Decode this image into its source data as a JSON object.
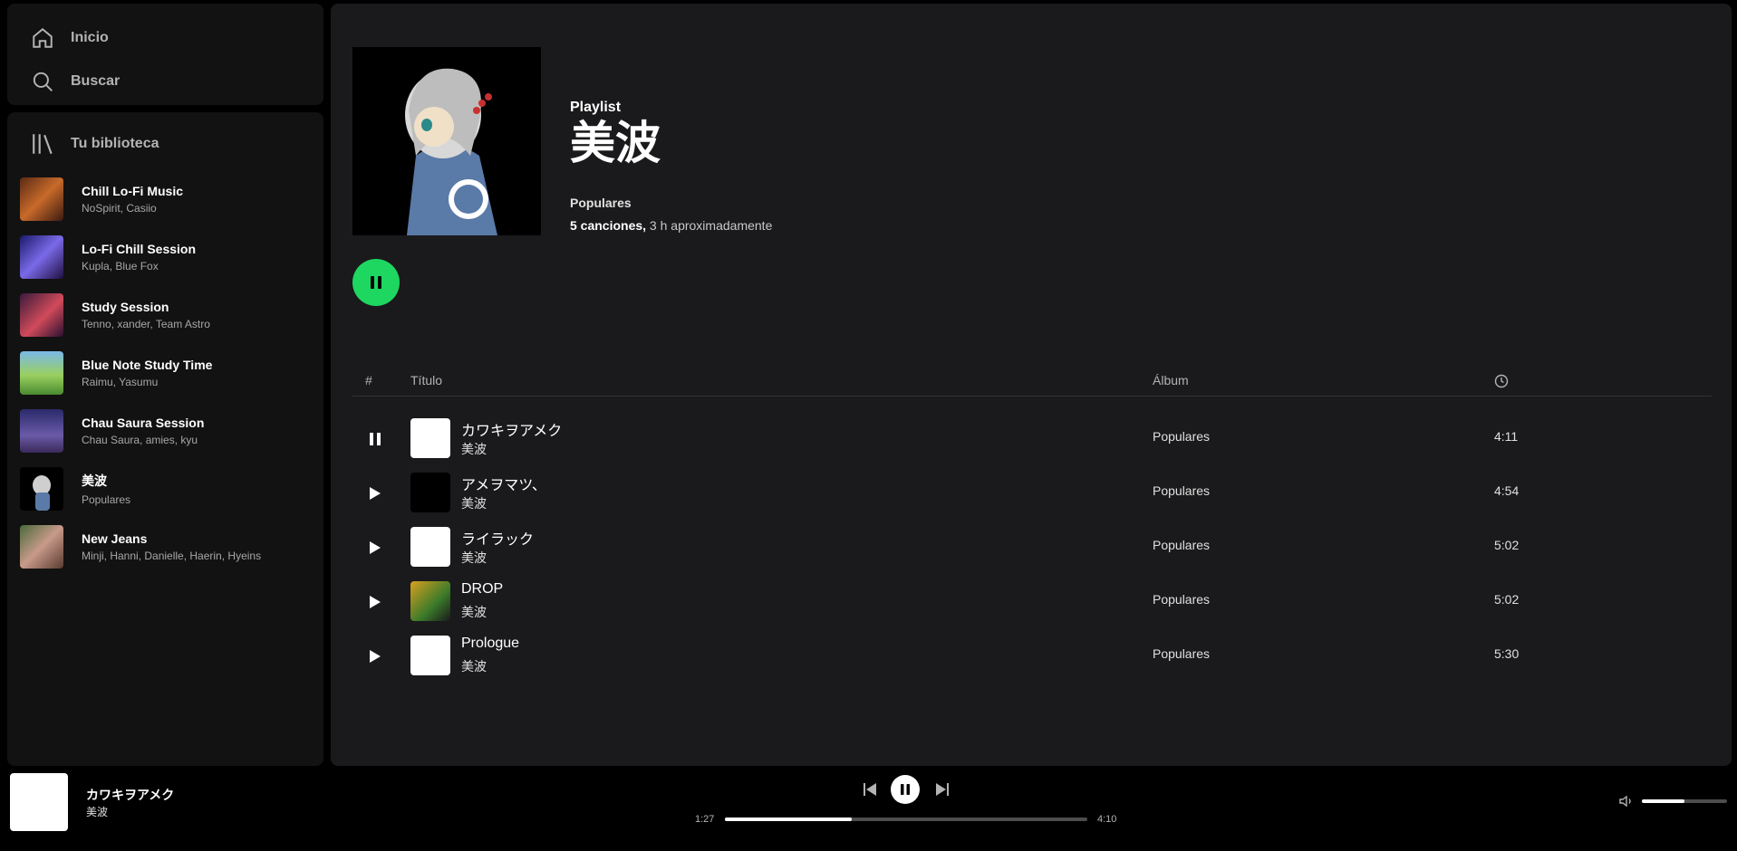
{
  "nav": {
    "home_label": "Inicio",
    "search_label": "Buscar"
  },
  "library": {
    "title": "Tu biblioteca",
    "items": [
      {
        "title": "Chill Lo-Fi Music",
        "subtitle": "NoSpirit, Casiio"
      },
      {
        "title": "Lo-Fi Chill Session",
        "subtitle": "Kupla, Blue Fox"
      },
      {
        "title": "Study Session",
        "subtitle": "Tenno, xander, Team Astro"
      },
      {
        "title": "Blue Note Study Time",
        "subtitle": "Raimu, Yasumu"
      },
      {
        "title": "Chau Saura Session",
        "subtitle": "Chau Saura, amies, kyu"
      },
      {
        "title": "美波",
        "subtitle": "Populares"
      },
      {
        "title": "New Jeans",
        "subtitle": "Minji, Hanni, Danielle, Haerin, Hyeins"
      }
    ]
  },
  "playlist": {
    "type": "Playlist",
    "name": "美波",
    "owner": "Populares",
    "songs_count": "5 canciones,",
    "duration": " 3 h aproximadamente"
  },
  "table": {
    "col_num": "#",
    "col_title": "Título",
    "col_album": "Álbum",
    "rows": [
      {
        "title": "カワキヲアメク",
        "artist": "美波",
        "album": "Populares",
        "duration": "4:11",
        "playing": true
      },
      {
        "title": "アメヲマツ、",
        "artist": "美波",
        "album": "Populares",
        "duration": "4:54"
      },
      {
        "title": "ライラック",
        "artist": "美波",
        "album": "Populares",
        "duration": "5:02"
      },
      {
        "title": "DROP",
        "artist": "美波",
        "album": "Populares",
        "duration": "5:02"
      },
      {
        "title": "Prologue",
        "artist": "美波",
        "album": "Populares",
        "duration": "5:30"
      }
    ]
  },
  "player": {
    "title": "カワキヲアメク",
    "artist": "美波",
    "current_time": "1:27",
    "total_time": "4:10",
    "progress": 0.35,
    "volume": 0.5
  },
  "colors": {
    "accent": "#1ed760",
    "panel": "#121212",
    "main": "#1a1a1c"
  }
}
